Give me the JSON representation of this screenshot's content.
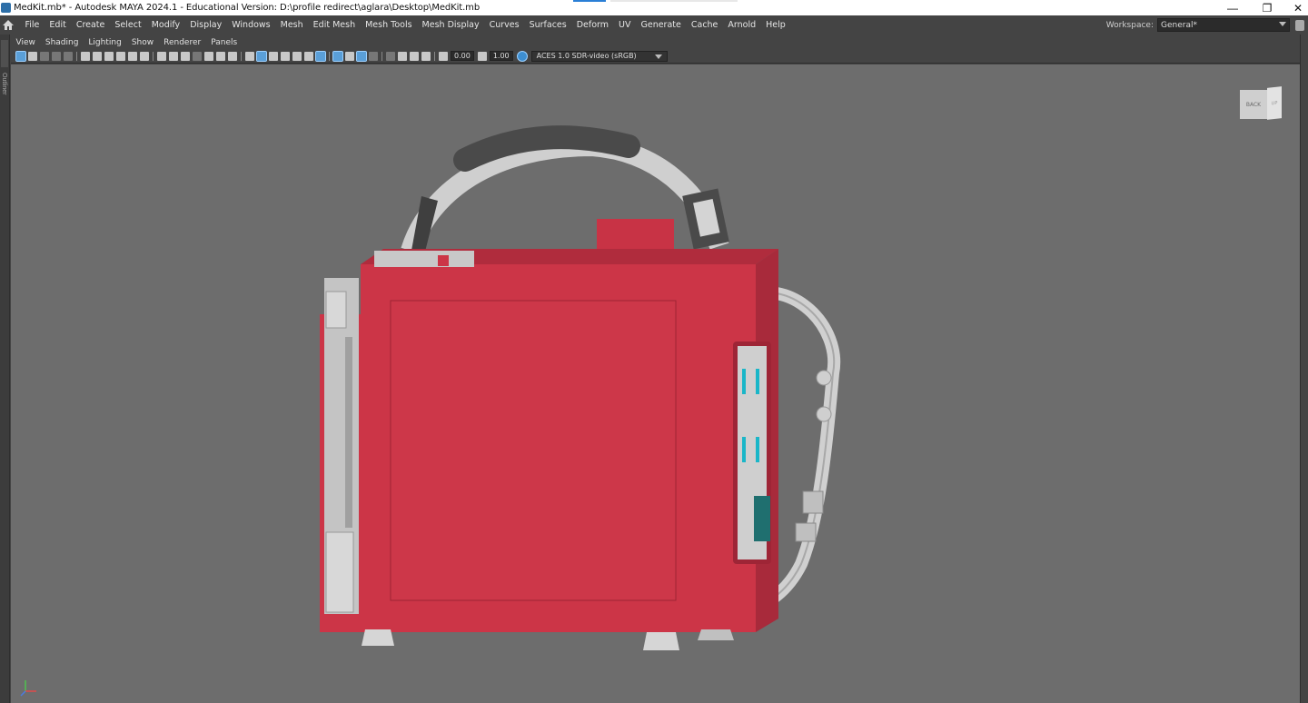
{
  "titlebar": {
    "title": "MedKit.mb* - Autodesk MAYA 2024.1 - Educational Version: D:\\profile redirect\\aglara\\Desktop\\MedKit.mb",
    "minimize": "—",
    "restore": "❐",
    "close": "✕"
  },
  "menubar": {
    "items": [
      "File",
      "Edit",
      "Create",
      "Select",
      "Modify",
      "Display",
      "Windows",
      "Mesh",
      "Edit Mesh",
      "Mesh Tools",
      "Mesh Display",
      "Curves",
      "Surfaces",
      "Deform",
      "UV",
      "Generate",
      "Cache",
      "Arnold",
      "Help"
    ]
  },
  "workspace": {
    "label": "Workspace:",
    "value": "General*"
  },
  "leftstrip": {
    "label": "Outliner"
  },
  "panel_menu": {
    "items": [
      "View",
      "Shading",
      "Lighting",
      "Show",
      "Renderer",
      "Panels"
    ]
  },
  "toolbar": {
    "exposure": "0.00",
    "gamma": "1.00",
    "color_space": "ACES 1.0 SDR-video (sRGB)"
  },
  "viewcube": {
    "back": "BACK",
    "up": "UP"
  },
  "colors": {
    "case_red": "#cc3547",
    "handle_gray": "#d2d2d2",
    "grip_dark": "#4a4a4a",
    "accent_cyan": "#1ab6c8",
    "viewport_bg": "#6d6d6d"
  }
}
